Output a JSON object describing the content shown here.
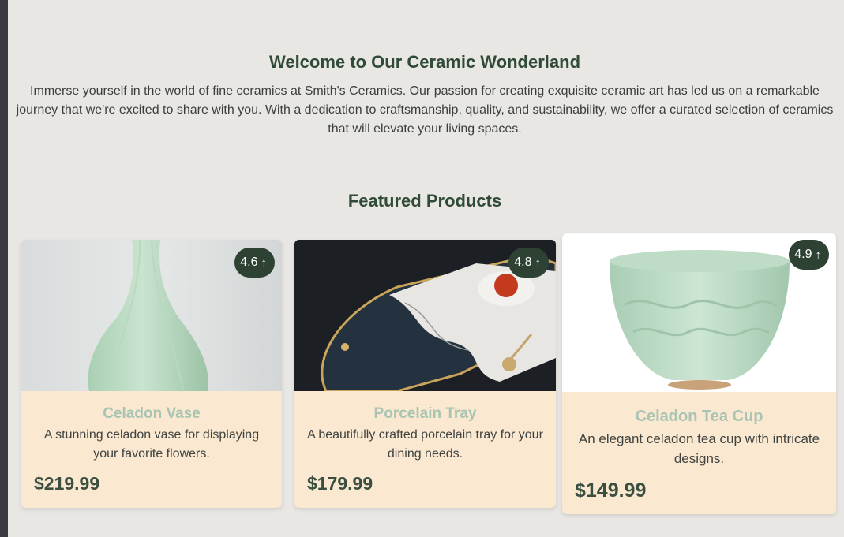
{
  "welcome": {
    "title": "Welcome to Our Ceramic Wonderland",
    "text": "Immerse yourself in the world of fine ceramics at Smith's Ceramics. Our passion for creating exquisite ceramic art has led us on a remarkable journey that we're excited to share with you. With a dedication to craftsmanship, quality, and sustainability, we offer a curated selection of ceramics that will elevate your living spaces."
  },
  "featured": {
    "title": "Featured Products"
  },
  "products": [
    {
      "name": "Celadon Vase",
      "description": "A stunning celadon vase for displaying your favorite flowers.",
      "price": "$219.99",
      "rating": "4.6",
      "rating_icon": "arrow-up-icon"
    },
    {
      "name": "Porcelain Tray",
      "description": "A beautifully crafted porcelain tray for your dining needs.",
      "price": "$179.99",
      "rating": "4.8",
      "rating_icon": "arrow-up-icon"
    },
    {
      "name": "Celadon Tea Cup",
      "description": "An elegant celadon tea cup with intricate designs.",
      "price": "$149.99",
      "rating": "4.9",
      "rating_icon": "arrow-up-icon"
    }
  ],
  "colors": {
    "background": "#e9e7e3",
    "card": "#fae8d1",
    "accent": "#2e4234",
    "product_name": "#a8c4b2"
  }
}
